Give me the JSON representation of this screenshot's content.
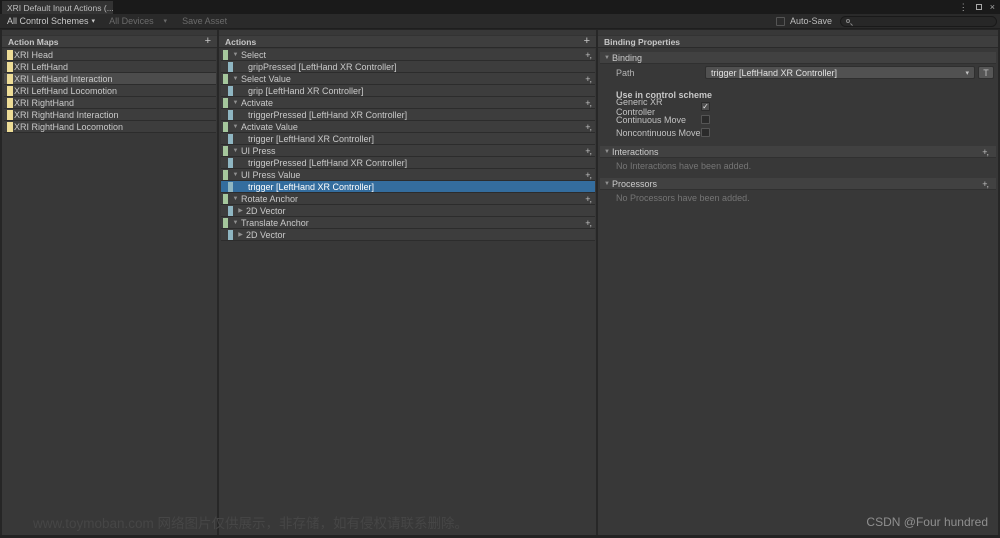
{
  "window": {
    "tab_title": "XRI Default Input Actions (...",
    "controls": {
      "menu": "⋮",
      "close": "×"
    }
  },
  "icons": {
    "fold_open": "▼",
    "fold_closed": "▶",
    "dropdown_arrow": "▾",
    "add": "+",
    "add_with_options": "+,",
    "check": "✓"
  },
  "toolbar": {
    "control_schemes": "All Control Schemes",
    "devices": "All Devices",
    "save_asset": "Save Asset",
    "auto_save_label": "Auto-Save",
    "auto_save_checked": false,
    "search_value": ""
  },
  "action_maps": {
    "header": "Action Maps",
    "items": [
      {
        "label": "XRI Head",
        "selected": false
      },
      {
        "label": "XRI LeftHand",
        "selected": false
      },
      {
        "label": "XRI LeftHand Interaction",
        "selected": true
      },
      {
        "label": "XRI LeftHand Locomotion",
        "selected": false
      },
      {
        "label": "XRI RightHand",
        "selected": false
      },
      {
        "label": "XRI RightHand Interaction",
        "selected": false
      },
      {
        "label": "XRI RightHand Locomotion",
        "selected": false
      }
    ]
  },
  "actions": {
    "header": "Actions",
    "rows": [
      {
        "type": "action",
        "label": "Select",
        "selected": false
      },
      {
        "type": "binding",
        "label": "gripPressed [LeftHand XR Controller]",
        "selected": false
      },
      {
        "type": "action",
        "label": "Select Value",
        "selected": false
      },
      {
        "type": "binding",
        "label": "grip [LeftHand XR Controller]",
        "selected": false
      },
      {
        "type": "action",
        "label": "Activate",
        "selected": false
      },
      {
        "type": "binding",
        "label": "triggerPressed [LeftHand XR Controller]",
        "selected": false
      },
      {
        "type": "action",
        "label": "Activate Value",
        "selected": false
      },
      {
        "type": "binding",
        "label": "trigger [LeftHand XR Controller]",
        "selected": false
      },
      {
        "type": "action",
        "label": "UI Press",
        "selected": false
      },
      {
        "type": "binding",
        "label": "triggerPressed [LeftHand XR Controller]",
        "selected": false
      },
      {
        "type": "action",
        "label": "UI Press Value",
        "selected": false
      },
      {
        "type": "binding",
        "label": "trigger [LeftHand XR Controller]",
        "selected": true
      },
      {
        "type": "action",
        "label": "Rotate Anchor",
        "selected": false
      },
      {
        "type": "composite",
        "label": "2D Vector",
        "selected": false
      },
      {
        "type": "action",
        "label": "Translate Anchor",
        "selected": false
      },
      {
        "type": "composite",
        "label": "2D Vector",
        "selected": false
      }
    ]
  },
  "binding_properties": {
    "header": "Binding Properties",
    "binding_section_title": "Binding",
    "path_label": "Path",
    "path_value": "trigger [LeftHand XR Controller]",
    "t_button": "T",
    "control_scheme_title": "Use in control scheme",
    "schemes": [
      {
        "label": "Generic XR Controller",
        "checked": true
      },
      {
        "label": "Continuous Move",
        "checked": false
      },
      {
        "label": "Noncontinuous Move",
        "checked": false
      }
    ],
    "interactions_title": "Interactions",
    "interactions_empty": "No Interactions have been added.",
    "processors_title": "Processors",
    "processors_empty": "No Processors have been added."
  },
  "watermarks": {
    "bottom_left": "www.toymoban.com 网络图片仅供展示，非存储，如有侵权请联系删除。",
    "bottom_right": "CSDN @Four hundred"
  },
  "colors": {
    "selection_blue": "#346D9E",
    "selection_gray": "#4C4C4C",
    "map_bar": "#EDDC96",
    "action_bar": "#A5C79C",
    "binding_bar": "#8FB6C2"
  }
}
